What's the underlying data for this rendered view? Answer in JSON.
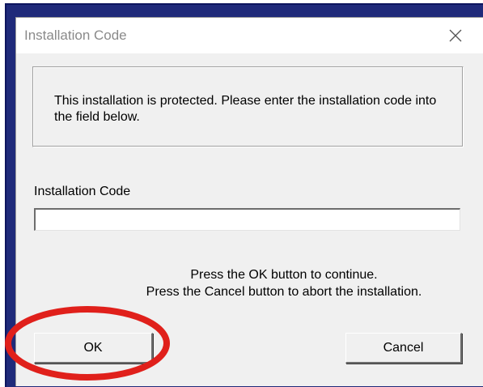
{
  "window": {
    "title": "Installation Code"
  },
  "message": "This installation is protected. Please enter the installation code into the field below.",
  "field": {
    "label": "Installation Code",
    "value": "",
    "placeholder": ""
  },
  "instructions": {
    "line1": "Press the OK button to continue.",
    "line2": "Press the Cancel button to abort the installation."
  },
  "buttons": {
    "ok": "OK",
    "cancel": "Cancel"
  },
  "icons": {
    "close": "close-icon"
  },
  "colors": {
    "frame": "#1f2a7a",
    "dialog": "#f0f0f0",
    "highlight": "#e0201b"
  }
}
